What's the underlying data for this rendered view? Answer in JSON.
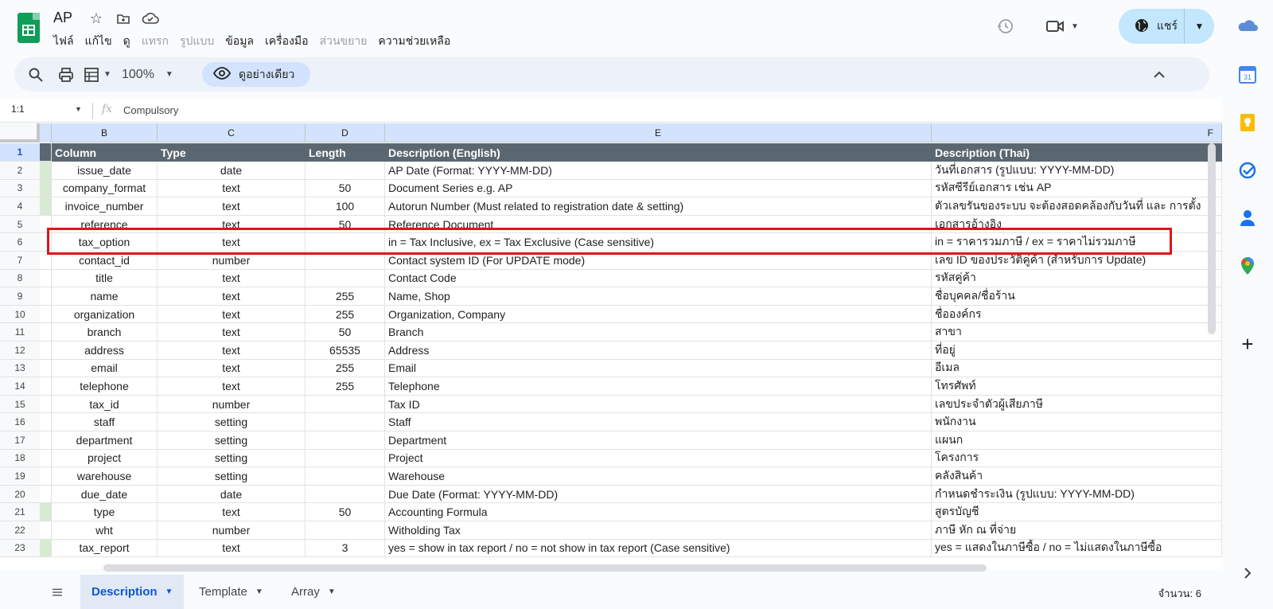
{
  "app": {
    "doc_title": "AP",
    "menus": [
      {
        "label": "ไฟล์",
        "enabled": true
      },
      {
        "label": "แก้ไข",
        "enabled": true
      },
      {
        "label": "ดู",
        "enabled": true
      },
      {
        "label": "แทรก",
        "enabled": false
      },
      {
        "label": "รูปแบบ",
        "enabled": false
      },
      {
        "label": "ข้อมูล",
        "enabled": true
      },
      {
        "label": "เครื่องมือ",
        "enabled": true
      },
      {
        "label": "ส่วนขยาย",
        "enabled": false
      },
      {
        "label": "ความช่วยเหลือ",
        "enabled": true
      }
    ],
    "share_label": "แชร์"
  },
  "toolbar": {
    "zoom": "100%",
    "preview_label": "ดูอย่างเดียว"
  },
  "formula_bar": {
    "cell_ref": "1:1",
    "fx": "fx",
    "value": "Compulsory"
  },
  "grid": {
    "column_letters": [
      "B",
      "C",
      "D",
      "E",
      "F"
    ],
    "headers": [
      "Column",
      "Type",
      "Length",
      "Description (English)",
      "Description (Thai)"
    ],
    "rows": [
      {
        "n": "2",
        "b": "issue_date",
        "c": "date",
        "d": "",
        "e": "AP Date (Format: YYYY-MM-DD)",
        "f": "วันที่เอกสาร (รูปแบบ: YYYY-MM-DD)",
        "green": true
      },
      {
        "n": "3",
        "b": "company_format",
        "c": "text",
        "d": "50",
        "e": "Document Series e.g. AP",
        "f": "รหัสซีรีย์เอกสาร เช่น AP",
        "green": true
      },
      {
        "n": "4",
        "b": "invoice_number",
        "c": "text",
        "d": "100",
        "e": "Autorun Number (Must related to registration date & setting)",
        "f": "ตัวเลขรันของระบบ จะต้องสอดคล้องกับวันที่ และ การตั้ง",
        "green": true
      },
      {
        "n": "5",
        "b": "reference",
        "c": "text",
        "d": "50",
        "e": "Reference Document",
        "f": "เอกสารอ้างอิง",
        "green": false
      },
      {
        "n": "6",
        "b": "tax_option",
        "c": "text",
        "d": "",
        "e": "in = Tax Inclusive, ex = Tax Exclusive (Case sensitive)",
        "f": "in = ราคารวมภาษี / ex =  ราคาไม่รวมภาษี",
        "green": false
      },
      {
        "n": "7",
        "b": "contact_id",
        "c": "number",
        "d": "",
        "e": "Contact system ID (For UPDATE mode)",
        "f": "เลข ID ของประวัติคู่ค้า (สำหรับการ Update)",
        "green": false
      },
      {
        "n": "8",
        "b": "title",
        "c": "text",
        "d": "",
        "e": "Contact Code",
        "f": "รหัสคู่ค้า",
        "green": false
      },
      {
        "n": "9",
        "b": "name",
        "c": "text",
        "d": "255",
        "e": "Name, Shop",
        "f": "ชื่อบุคคล/ชื่อร้าน",
        "green": false
      },
      {
        "n": "10",
        "b": "organization",
        "c": "text",
        "d": "255",
        "e": "Organization, Company",
        "f": "ชื่อองค์กร",
        "green": false
      },
      {
        "n": "11",
        "b": "branch",
        "c": "text",
        "d": "50",
        "e": "Branch",
        "f": "สาขา",
        "green": false
      },
      {
        "n": "12",
        "b": "address",
        "c": "text",
        "d": "65535",
        "e": "Address",
        "f": "ที่อยู่",
        "green": false
      },
      {
        "n": "13",
        "b": "email",
        "c": "text",
        "d": "255",
        "e": "Email",
        "f": "อีเมล",
        "green": false
      },
      {
        "n": "14",
        "b": "telephone",
        "c": "text",
        "d": "255",
        "e": "Telephone",
        "f": "โทรศัพท์",
        "green": false
      },
      {
        "n": "15",
        "b": "tax_id",
        "c": "number",
        "d": "",
        "e": "Tax ID",
        "f": "เลขประจำตัวผู้เสียภาษี",
        "green": false
      },
      {
        "n": "16",
        "b": "staff",
        "c": "setting",
        "d": "",
        "e": "Staff",
        "f": "พนักงาน",
        "green": false
      },
      {
        "n": "17",
        "b": "department",
        "c": "setting",
        "d": "",
        "e": "Department",
        "f": "แผนก",
        "green": false
      },
      {
        "n": "18",
        "b": "project",
        "c": "setting",
        "d": "",
        "e": "Project",
        "f": "โครงการ",
        "green": false
      },
      {
        "n": "19",
        "b": "warehouse",
        "c": "setting",
        "d": "",
        "e": "Warehouse",
        "f": "คลังสินค้า",
        "green": false
      },
      {
        "n": "20",
        "b": "due_date",
        "c": "date",
        "d": "",
        "e": "Due Date (Format: YYYY-MM-DD)",
        "f": "กำหนดชำระเงิน (รูปแบบ: YYYY-MM-DD)",
        "green": false
      },
      {
        "n": "21",
        "b": "type",
        "c": "text",
        "d": "50",
        "e": "Accounting Formula",
        "f": "สูตรบัญชี",
        "green": true
      },
      {
        "n": "22",
        "b": "wht",
        "c": "number",
        "d": "",
        "e": "Witholding Tax",
        "f": "ภาษี หัก ณ ที่จ่าย",
        "green": false
      },
      {
        "n": "23",
        "b": "tax_report",
        "c": "text",
        "d": "3",
        "e": "yes = show in tax report / no = not show in tax report (Case sensitive)",
        "f": "yes = แสดงในภาษีซื้อ / no = ไม่แสดงในภาษีซื้อ",
        "green": true
      }
    ]
  },
  "sheets": {
    "tabs": [
      "Description",
      "Template",
      "Array"
    ],
    "active": "Description",
    "count_label": "จำนวน: 6"
  },
  "colors": {
    "header_bg": "#5b6770",
    "highlight_border": "#e0141b",
    "share_bg": "#c2e7ff",
    "selected_col_bg": "#d3e3fd"
  }
}
